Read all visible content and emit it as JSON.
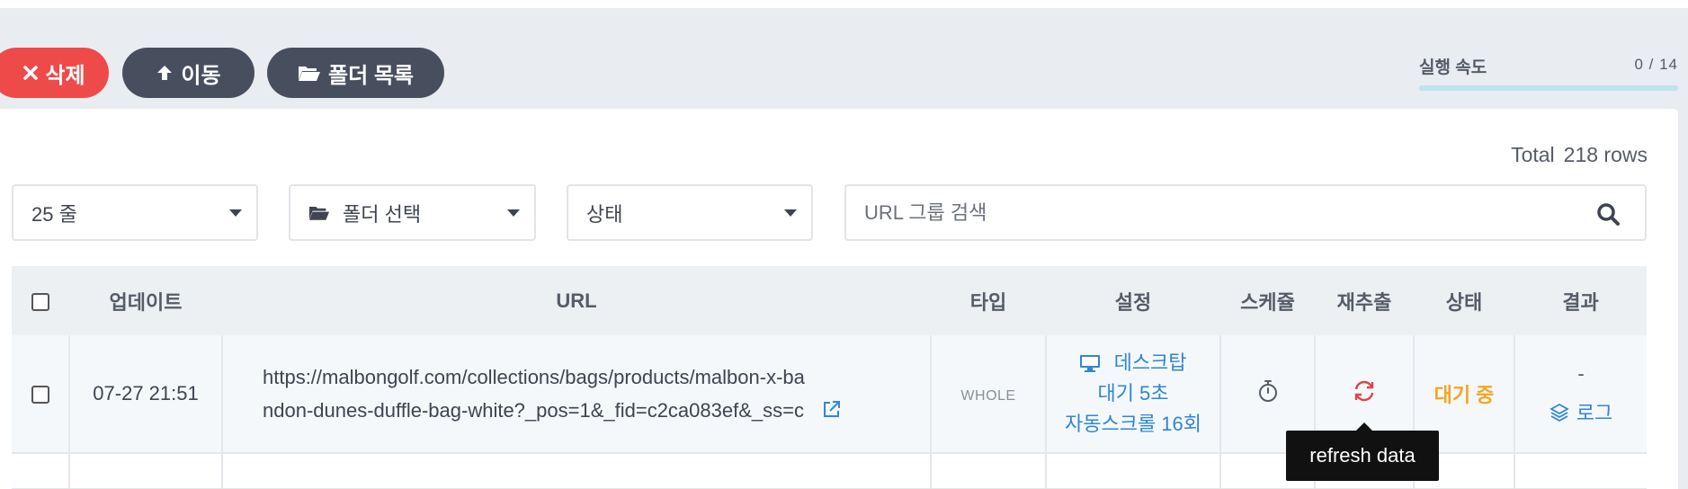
{
  "toolbar": {
    "delete_label": "삭제",
    "move_label": "이동",
    "folders_label": "폴더 목록",
    "colors": {
      "delete": "#ef4a4a",
      "dark": "#474f5f"
    }
  },
  "speed": {
    "label": "실행 속도",
    "value": "0 / 14",
    "progress": 0
  },
  "summary": {
    "total_label": "Total",
    "rows": "218 rows"
  },
  "filters": {
    "rows_per_page": "25 줄",
    "folder": "폴더 선택",
    "status": "상태",
    "search_placeholder": "URL 그룹 검색"
  },
  "table": {
    "headers": [
      "업데이트",
      "URL",
      "타입",
      "설정",
      "스케쥴",
      "재추출",
      "상태",
      "결과"
    ],
    "rows": [
      {
        "updated": "07-27 21:51",
        "url_line1": "https://malbongolf.com/collections/bags/products/malbon-x-ba",
        "url_line2": "ndon-dunes-duffle-bag-white?_pos=1&_fid=c2ca083ef&_ss=c",
        "type": "WHOLE",
        "settings_device": "데스크탑",
        "settings_wait": "대기  5초",
        "settings_scroll": "자동스크롤  16회",
        "status": "대기 중",
        "result_dash": "-",
        "result_log": "로그"
      }
    ]
  },
  "tooltip": "refresh data",
  "icons": [
    "times-icon",
    "arrow-up-icon",
    "folder-open-icon",
    "search-icon",
    "desktop-icon",
    "external-link-icon",
    "stopwatch-icon",
    "refresh-icon",
    "layers-icon"
  ]
}
